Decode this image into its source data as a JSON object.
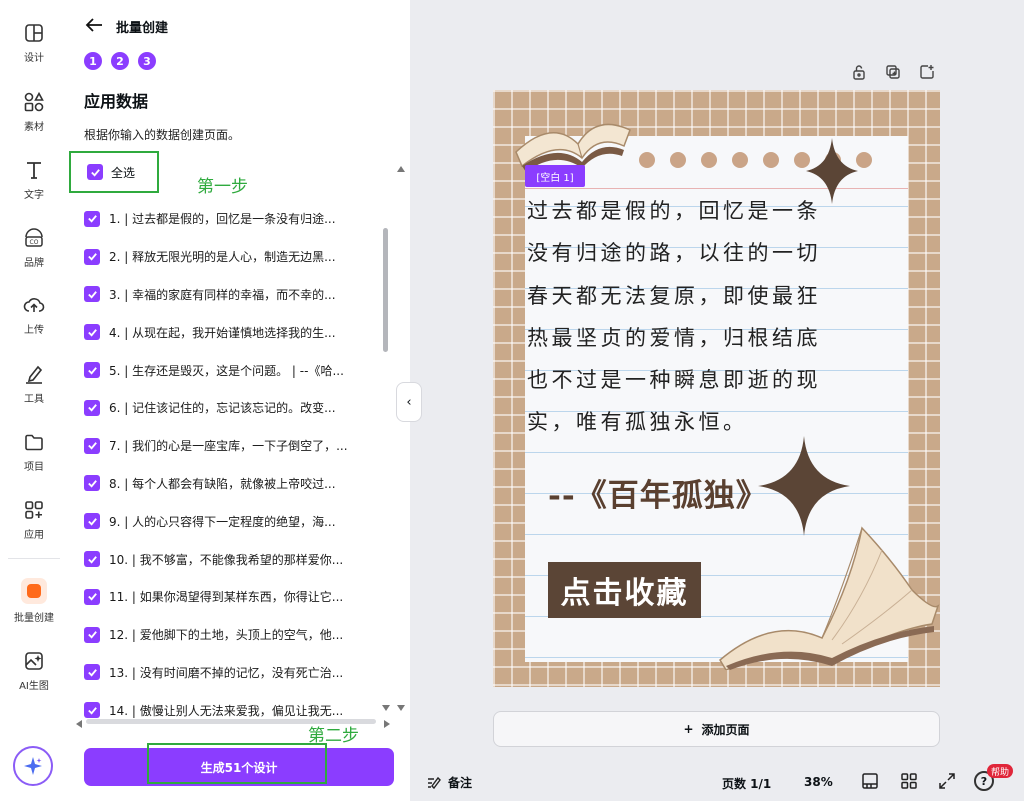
{
  "rail": {
    "items": [
      {
        "label": "设计",
        "icon": "layout-icon"
      },
      {
        "label": "素材",
        "icon": "elements-icon"
      },
      {
        "label": "文字",
        "icon": "text-icon"
      },
      {
        "label": "品牌",
        "icon": "brand-icon"
      },
      {
        "label": "上传",
        "icon": "upload-cloud-icon"
      },
      {
        "label": "工具",
        "icon": "pen-tool-icon"
      },
      {
        "label": "项目",
        "icon": "folder-icon"
      },
      {
        "label": "应用",
        "icon": "apps-icon"
      },
      {
        "label": "批量创建",
        "icon": "bulk-create-icon"
      },
      {
        "label": "AI生图",
        "icon": "ai-image-icon"
      }
    ],
    "active": "批量创建"
  },
  "panel": {
    "title": "批量创建",
    "steps": [
      "1",
      "2",
      "3"
    ],
    "section_title": "应用数据",
    "description": "根据你输入的数据创建页面。",
    "select_all_label": "全选",
    "annotation_step1": "第一步",
    "annotation_step2": "第二步",
    "rows": [
      "1. | 过去都是假的，回忆是一条没有归途...",
      "2. | 释放无限光明的是人心，制造无边黑...",
      "3. | 幸福的家庭有同样的幸福，而不幸的...",
      "4. | 从现在起，我开始谨慎地选择我的生...",
      "5. | 生存还是毁灭，这是个问题。 | --《哈...",
      "6. | 记住该记住的，忘记该忘记的。改变...",
      "7. | 我们的心是一座宝库，一下子倒空了，...",
      "8. | 每个人都会有缺陷，就像被上帝咬过...",
      "9. | 人的心只容得下一定程度的绝望，海...",
      "10. | 我不够富，不能像我希望的那样爱你...",
      "11. | 如果你渴望得到某样东西，你得让它...",
      "12. | 爱他脚下的土地，头顶上的空气，他...",
      "13. | 没有时间磨不掉的记忆，没有死亡治...",
      "14. | 傲慢让别人无法来爱我，偏见让我无..."
    ],
    "generate_button": "生成51个设计",
    "collapse_glyph": "‹"
  },
  "design": {
    "placeholder_tag": "[空白 1]",
    "poem_lines": [
      "过去都是假的，回忆是一条",
      "没有归途的路，以往的一切",
      "春天都无法复原，即使最狂",
      "热最坚贞的爱情，归根结底",
      "也不过是一种瞬息即逝的现",
      "实，唯有孤独永恒。"
    ],
    "source": "--《百年孤独》",
    "favorite_label": "点击收藏",
    "colors": {
      "frame": "#c9a98a",
      "accent": "#5b4536",
      "brand": "#8b3dff"
    }
  },
  "canvas": {
    "add_page_label": "添加页面",
    "add_page_glyph": "+"
  },
  "bottom": {
    "notes_label": "备注",
    "pages_label": "页数 1/1",
    "zoom": "38%",
    "help_glyph": "?",
    "help_badge": "帮助"
  }
}
